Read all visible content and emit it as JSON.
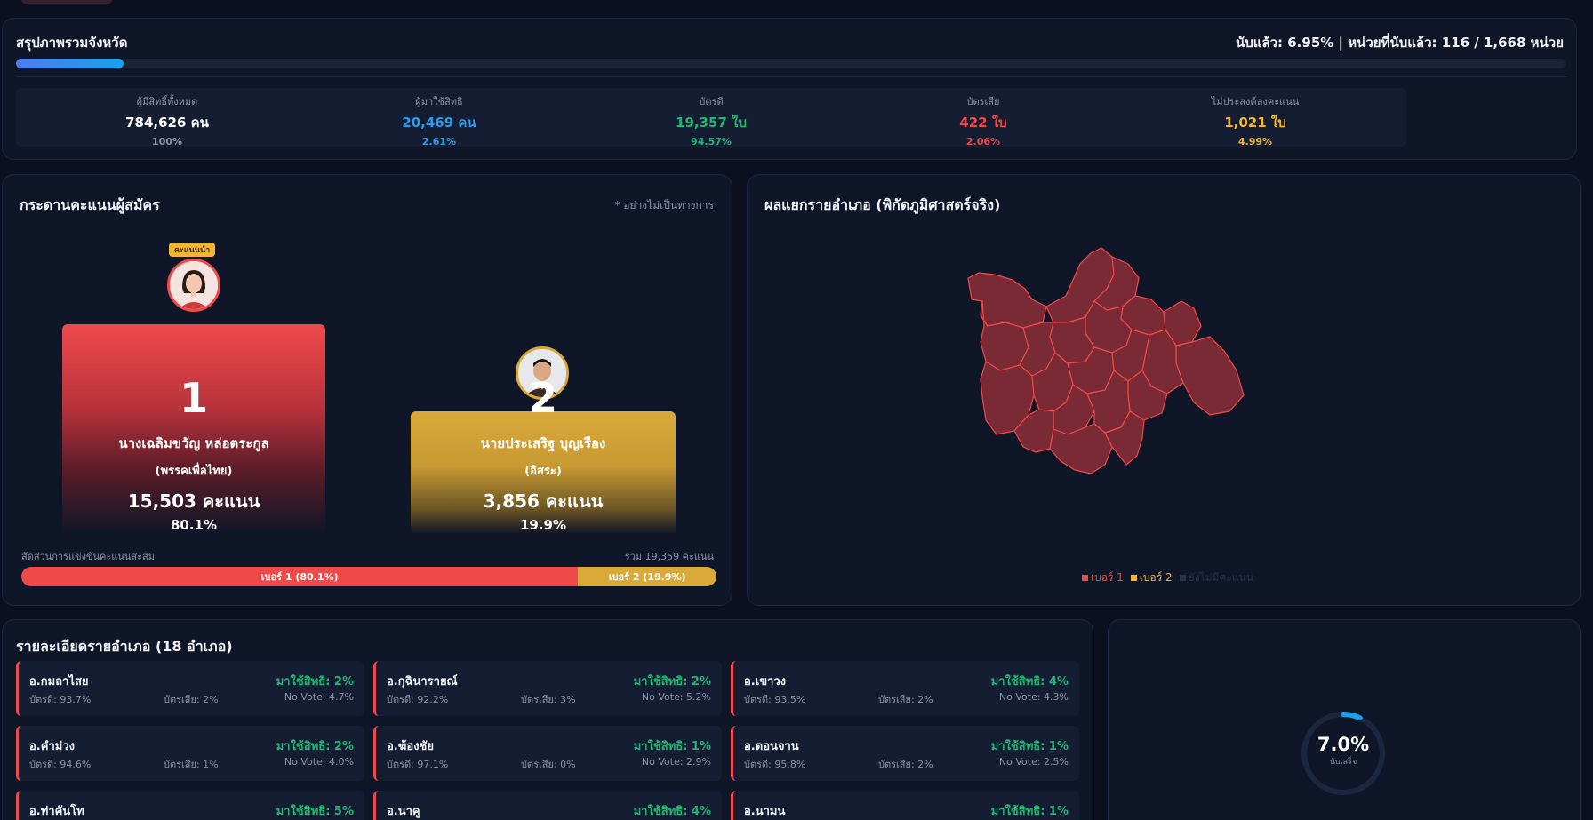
{
  "summary": {
    "title": "สรุปภาพรวมจังหวัด",
    "status": "นับแล้ว: 6.95% | หน่วยที่นับแล้ว: 116 / 1,668 หน่วย",
    "progress_percent": 6.95,
    "stats": [
      {
        "label": "ผู้มีสิทธิ์ทั้งหมด",
        "value": "784,626 คน",
        "pct": "100%",
        "color": "#ffffff",
        "pct_color": "#8a93aa"
      },
      {
        "label": "ผู้มาใช้สิทธิ",
        "value": "20,469 คน",
        "pct": "2.61%",
        "color": "#2f9be8",
        "pct_color": "#2f9be8"
      },
      {
        "label": "บัตรดี",
        "value": "19,357 ใบ",
        "pct": "94.57%",
        "color": "#22b573",
        "pct_color": "#22b573"
      },
      {
        "label": "บัตรเสีย",
        "value": "422 ใบ",
        "pct": "2.06%",
        "color": "#ef4a4a",
        "pct_color": "#ef4a4a"
      },
      {
        "label": "ไม่ประสงค์ลงคะแนน",
        "value": "1,021 ใบ",
        "pct": "4.99%",
        "color": "#f2b632",
        "pct_color": "#f2b632"
      }
    ]
  },
  "scoreboard": {
    "title": "กระดานคะแนนผู้สมัคร",
    "note": "* อย่างไม่เป็นทางการ",
    "lead_badge": "คะแนนนำ",
    "candidates": [
      {
        "number": "1",
        "name": "นางเฉลิมขวัญ หล่อตระกูล",
        "party": "(พรรคเพื่อไทย)",
        "votes": "15,503 คะแนน",
        "pct": "80.1%",
        "color": "#ef4a4a"
      },
      {
        "number": "2",
        "name": "นายประเสริฐ บุญเรือง",
        "party": "(อิสระ)",
        "votes": "3,856 คะแนน",
        "pct": "19.9%",
        "color": "#d9a93a"
      }
    ],
    "share_label": "สัดส่วนการแข่งขันคะแนนสะสม",
    "share_total": "รวม 19,359 คะแนน",
    "share_segments": [
      {
        "label": "เบอร์ 1 (80.1%)",
        "share": 80.1
      },
      {
        "label": "เบอร์ 2 (19.9%)",
        "share": 19.9
      }
    ]
  },
  "map": {
    "title": "ผลแยกรายอำเภอ (พิกัดภูมิศาสตร์จริง)",
    "fill_color": "#7a2a34",
    "stroke_color": "#ef4a4a",
    "legend": [
      {
        "label": "เบอร์ 1",
        "color": "#ef4a4a"
      },
      {
        "label": "เบอร์ 2",
        "color": "#f2b632"
      },
      {
        "label": "ยังไม่มีคะแนน",
        "color": "#2a3146"
      }
    ]
  },
  "districts": {
    "title": "รายละเอียดรายอำเภอ (18 อำเภอ)",
    "items": [
      {
        "name": "อ.กมลาไสย",
        "turnout": "มาใช้สิทธิ: 2%",
        "good": "บัตรดี: 93.7%",
        "bad": "บัตรเสีย: 2%",
        "novote": "No Vote: 4.7%"
      },
      {
        "name": "อ.กุฉินารายณ์",
        "turnout": "มาใช้สิทธิ: 2%",
        "good": "บัตรดี: 92.2%",
        "bad": "บัตรเสีย: 3%",
        "novote": "No Vote: 5.2%"
      },
      {
        "name": "อ.เขาวง",
        "turnout": "มาใช้สิทธิ: 4%",
        "good": "บัตรดี: 93.5%",
        "bad": "บัตรเสีย: 2%",
        "novote": "No Vote: 4.3%"
      },
      {
        "name": "อ.คำม่วง",
        "turnout": "มาใช้สิทธิ: 2%",
        "good": "บัตรดี: 94.6%",
        "bad": "บัตรเสีย: 1%",
        "novote": "No Vote: 4.0%"
      },
      {
        "name": "อ.ฆ้องชัย",
        "turnout": "มาใช้สิทธิ: 1%",
        "good": "บัตรดี: 97.1%",
        "bad": "บัตรเสีย: 0%",
        "novote": "No Vote: 2.9%"
      },
      {
        "name": "อ.ดอนจาน",
        "turnout": "มาใช้สิทธิ: 1%",
        "good": "บัตรดี: 95.8%",
        "bad": "บัตรเสีย: 2%",
        "novote": "No Vote: 2.5%"
      },
      {
        "name": "อ.ท่าคันโท",
        "turnout": "มาใช้สิทธิ: 5%",
        "good": "",
        "bad": "",
        "novote": ""
      },
      {
        "name": "อ.นาคู",
        "turnout": "มาใช้สิทธิ: 4%",
        "good": "",
        "bad": "",
        "novote": ""
      },
      {
        "name": "อ.นามน",
        "turnout": "มาใช้สิทธิ: 1%",
        "good": "",
        "bad": "",
        "novote": ""
      }
    ]
  },
  "ring": {
    "value": "7.0%",
    "percent": 7.0,
    "label": "นับเสร็จ",
    "color": "#1aa0e8"
  }
}
